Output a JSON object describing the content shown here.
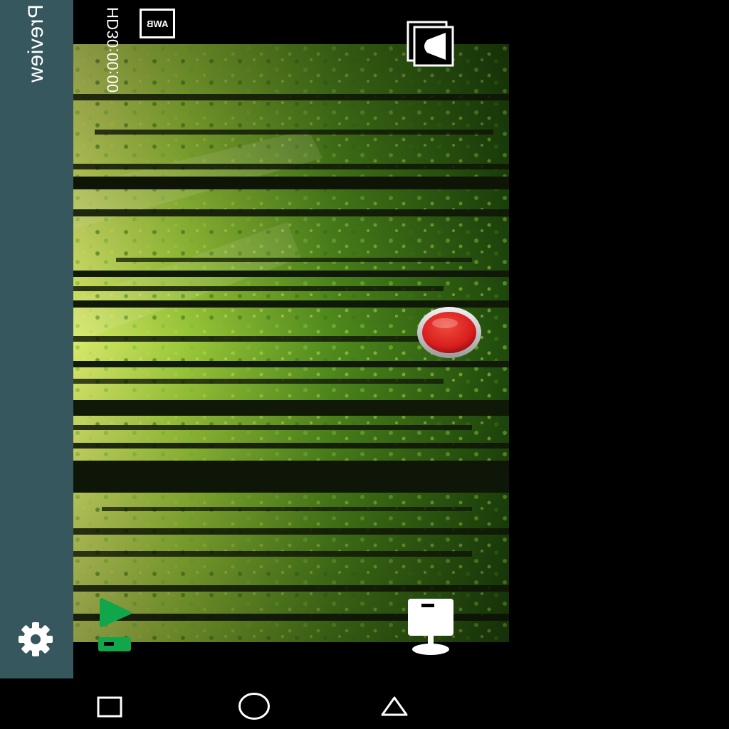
{
  "sidebar": {
    "title": "Preview",
    "settings_icon": "gear-icon"
  },
  "status": {
    "resolution_timer": "HD30:00:00",
    "awb_label": "AWB"
  },
  "controls": {
    "mode_icon": "camera-switch-icon",
    "record_icon": "record-icon",
    "record_color": "#d81e1e",
    "play_icon": "play-icon",
    "play_color": "#12a64a",
    "gallery_icon": "monitor-icon"
  },
  "nav": {
    "recents_icon": "square-icon",
    "home_icon": "circle-icon",
    "back_icon": "triangle-icon"
  }
}
